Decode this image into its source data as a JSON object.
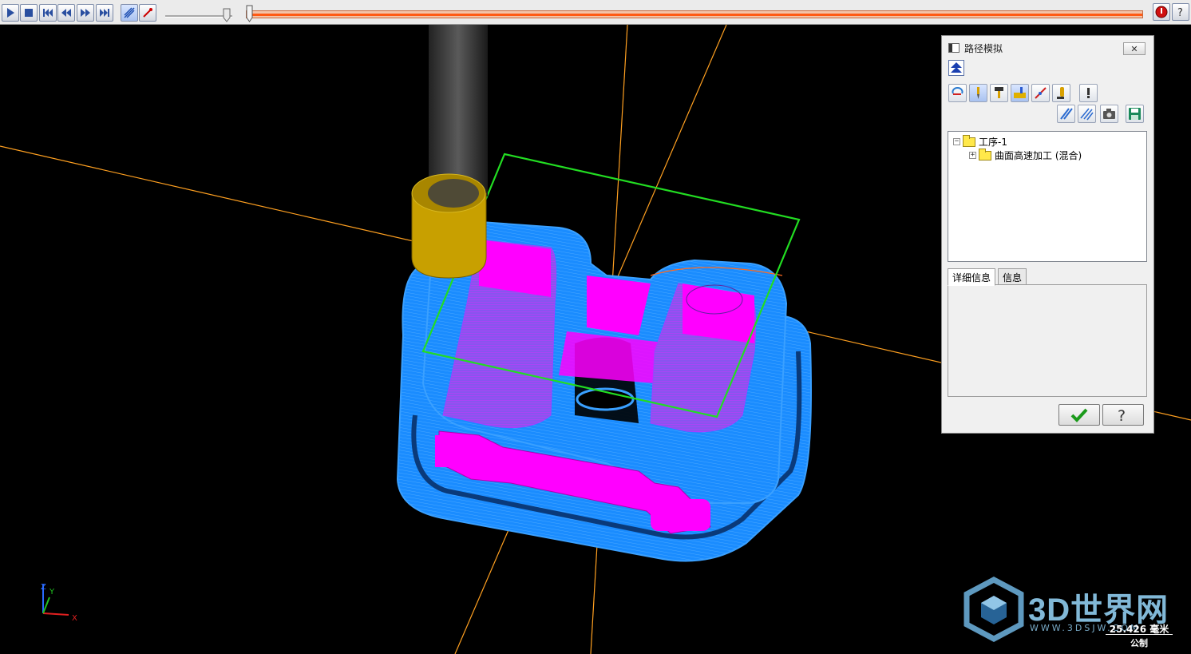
{
  "toolbar": {
    "buttons": [
      "play-icon",
      "stop-icon",
      "go-to-start-icon",
      "step-back-icon",
      "step-forward-icon",
      "go-to-end-icon",
      "trace-path-icon",
      "tool-trace-icon"
    ],
    "speed": 0.9,
    "progress": 0.005,
    "right_buttons": [
      "stop-red-icon",
      "help-icon"
    ]
  },
  "dialog": {
    "title": "路径模拟",
    "close_label": "✕",
    "tree": {
      "root": "工序-1",
      "child": "曲面高速加工 (混合)"
    },
    "tabs": [
      "详细信息",
      "信息"
    ],
    "ok_icon": "checkmark-icon",
    "help_icon": "question-icon"
  },
  "axes": {
    "x": "X",
    "y": "Y",
    "z": "Z"
  },
  "watermark": {
    "brand": "3D世界网",
    "url": "WWW.3DSJW.COM"
  },
  "scale": {
    "value": "25.426 毫米",
    "unit": "公制"
  },
  "colors": {
    "toolpath": "#1a8cff",
    "part": "#ff00ff",
    "tool_holder": "#c8a000",
    "stock_box": "#22dd22",
    "guide_lines": "#ffa020",
    "progress": "#ff5a14"
  }
}
